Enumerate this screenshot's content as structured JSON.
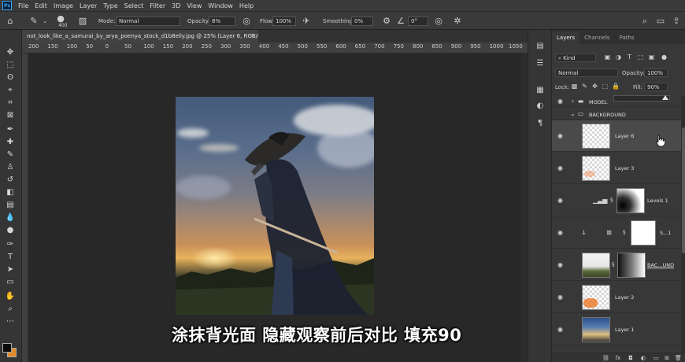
{
  "menu": {
    "logo": "Ps",
    "items": [
      "File",
      "Edit",
      "Image",
      "Layer",
      "Type",
      "Select",
      "Filter",
      "3D",
      "View",
      "Window",
      "Help"
    ]
  },
  "options": {
    "brush_size": "400",
    "mode_label": "Mode:",
    "mode_value": "Normal",
    "opacity_label": "Opacity:",
    "opacity_value": "8%",
    "flow_label": "Flow:",
    "flow_value": "100%",
    "smoothing_label": "Smoothing:",
    "smoothing_value": "0%",
    "angle_value": "0°"
  },
  "document": {
    "tab_title": "not_look_like_a_samurai_by_arya_poenya_stock_d1b8elly.jpg @ 25% (Layer 6, RGB/8) *",
    "close_glyph": "×"
  },
  "ruler": {
    "ticks": [
      "200",
      "150",
      "100",
      "50",
      "0",
      "50",
      "100",
      "150",
      "200",
      "250",
      "300",
      "350",
      "400",
      "450",
      "500",
      "550",
      "600",
      "650",
      "700",
      "750",
      "800",
      "850",
      "900",
      "950",
      "1000",
      "1050"
    ]
  },
  "subtitle": "涂抹背光面 隐藏观察前后对比 填充90",
  "panel": {
    "tabs": [
      "Layers",
      "Channels",
      "Paths"
    ],
    "active_tab": "Layers",
    "filter_kind": "Kind",
    "blend_mode": "Normal",
    "opacity_label": "Opacity:",
    "opacity_value": "100%",
    "lock_label": "Lock:",
    "fill_label": "Fill:",
    "fill_value": "90%",
    "fill_slider_value": 0.9
  },
  "layers": [
    {
      "name": "MODEL",
      "type": "group",
      "collapsed": true
    },
    {
      "name": "BACKGROUND",
      "type": "group",
      "collapsed": false
    },
    {
      "name": "Layer 6",
      "type": "pixel",
      "selected": true
    },
    {
      "name": "Layer 3",
      "type": "pixel"
    },
    {
      "name": "Levels 1",
      "type": "adjustment"
    },
    {
      "name": "S...1",
      "type": "smart"
    },
    {
      "name": "BAC...UND",
      "type": "pixel-mask"
    },
    {
      "name": "Layer 2",
      "type": "pixel"
    },
    {
      "name": "Layer 1",
      "type": "pixel"
    }
  ],
  "colors": {
    "accent": "#31a8ff",
    "foreground_swatch": "#0a0a0a",
    "background_swatch": "#e08a2a"
  }
}
